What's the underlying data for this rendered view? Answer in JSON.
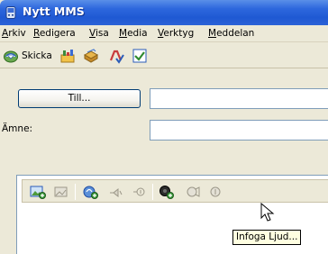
{
  "window": {
    "title": "Nytt MMS"
  },
  "menu": [
    {
      "underline": "A",
      "rest": "rkiv"
    },
    {
      "underline": "R",
      "rest": "edigera"
    },
    {
      "underline": "V",
      "rest": "isa"
    },
    {
      "underline": "M",
      "rest": "edia"
    },
    {
      "underline": "V",
      "rest": "erktyg"
    },
    {
      "underline": "M",
      "rest": "eddelan"
    }
  ],
  "toolbar": {
    "send_label": "Skicka",
    "icons": [
      "send-icon",
      "contact-card-icon",
      "attach-icon",
      "spell-check-icon",
      "check-icon"
    ]
  },
  "address": {
    "to_button": "Till...",
    "subject_label": "Ämne:"
  },
  "format_toolbar": {
    "icons": [
      "add-image-icon",
      "image-disabled-icon",
      "add-sound-icon",
      "sound-disabled-icon",
      "sound-off-icon",
      "insert-audio-icon",
      "video-disabled-icon",
      "video-disabled-2-icon"
    ]
  },
  "tooltip": "Infoga Ljud..."
}
